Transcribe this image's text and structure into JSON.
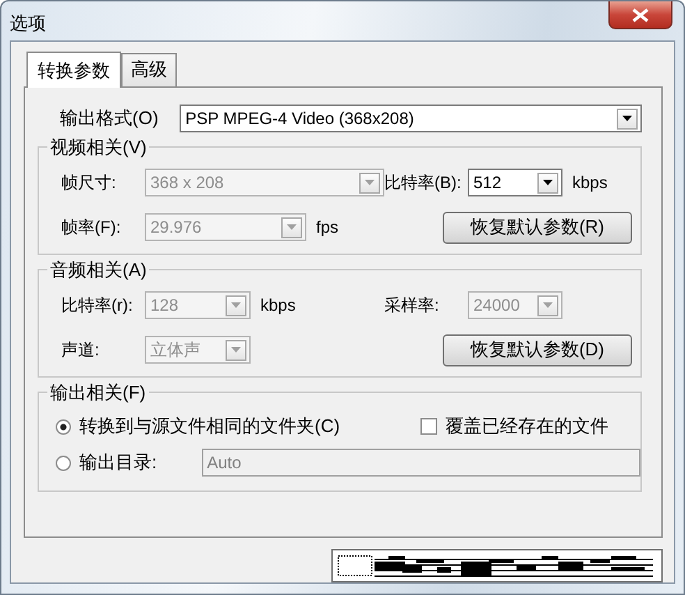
{
  "window": {
    "title": "选项"
  },
  "tabs": [
    {
      "label": "转换参数",
      "selected": true
    },
    {
      "label": "高级",
      "selected": false
    }
  ],
  "output_format": {
    "label": "输出格式(O)",
    "value": "PSP MPEG-4 Video (368x208)",
    "disabled": false
  },
  "video": {
    "title": "视频相关(V)",
    "rows": [
      [
        {
          "label": "帧尺寸:",
          "value": "368 x 208",
          "disabled": true
        },
        {
          "label": "比特率(B):",
          "value": "512",
          "disabled": false,
          "unit": "kbps"
        }
      ],
      [
        {
          "label": "帧率(F):",
          "value": "29.976",
          "disabled": true,
          "unit": "fps"
        },
        {
          "button": "恢复默认参数(R)"
        }
      ]
    ]
  },
  "audio": {
    "title": "音频相关(A)",
    "rows": [
      [
        {
          "label": "比特率(r):",
          "value": "128",
          "disabled": true,
          "unit": "kbps"
        },
        {
          "label": "采样率:",
          "value": "24000",
          "disabled": true
        }
      ],
      [
        {
          "label": "声道:",
          "value": "立体声",
          "disabled": true
        },
        {
          "button": "恢复默认参数(D)"
        }
      ]
    ]
  },
  "output": {
    "title": "输出相关(F)",
    "options": [
      {
        "label": "转换到与源文件相同的文件夹(C)",
        "selected": true
      },
      {
        "label": "输出目录:",
        "selected": false,
        "path": "Auto"
      }
    ],
    "overwrite": {
      "label": "覆盖已经存在的文件",
      "checked": false
    }
  }
}
